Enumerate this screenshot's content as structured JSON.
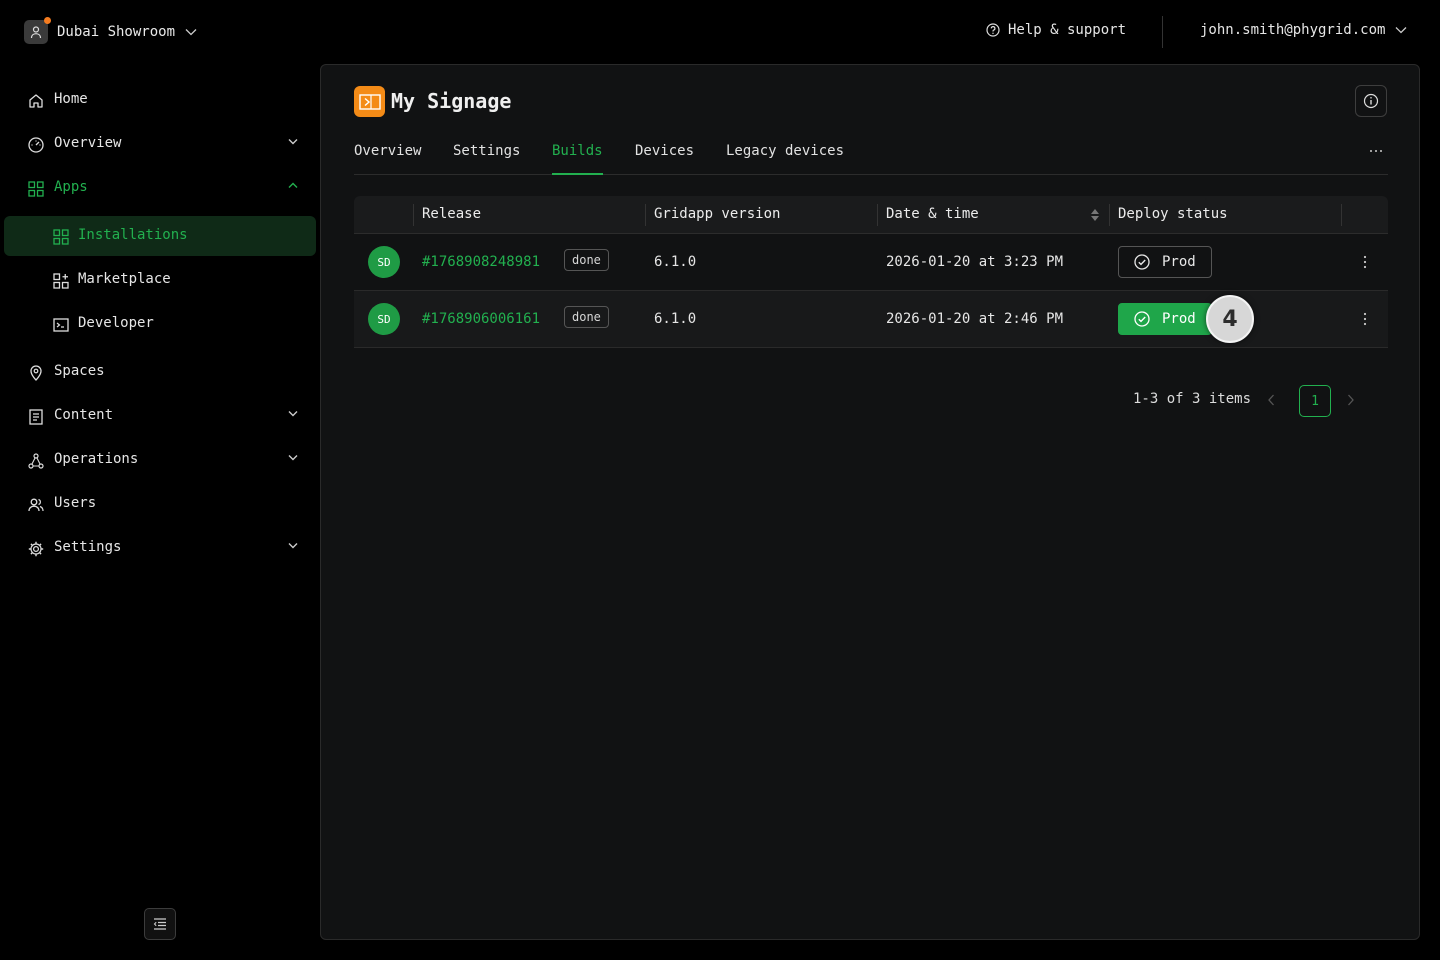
{
  "workspace": {
    "name": "Dubai Showroom"
  },
  "header": {
    "help_label": "Help & support",
    "user_email": "john.smith@phygrid.com"
  },
  "sidebar": {
    "items": [
      {
        "label": "Home"
      },
      {
        "label": "Overview"
      },
      {
        "label": "Apps"
      },
      {
        "label": "Installations"
      },
      {
        "label": "Marketplace"
      },
      {
        "label": "Developer"
      },
      {
        "label": "Spaces"
      },
      {
        "label": "Content"
      },
      {
        "label": "Operations"
      },
      {
        "label": "Users"
      },
      {
        "label": "Settings"
      }
    ]
  },
  "app": {
    "title": "My Signage"
  },
  "tabs": [
    {
      "label": "Overview"
    },
    {
      "label": "Settings"
    },
    {
      "label": "Builds",
      "active": true
    },
    {
      "label": "Devices"
    },
    {
      "label": "Legacy devices"
    }
  ],
  "table": {
    "columns": [
      "Release",
      "Gridapp version",
      "Date & time",
      "Deploy status"
    ],
    "rows": [
      {
        "avatar": "SD",
        "release": "#1768908248981",
        "status": "done",
        "version": "6.1.0",
        "datetime": "2026-01-20 at 3:23 PM",
        "deploy": "Prod",
        "deploy_filled": false
      },
      {
        "avatar": "SD",
        "release": "#1768906006161",
        "status": "done",
        "version": "6.1.0",
        "datetime": "2026-01-20 at 2:46 PM",
        "deploy": "Prod",
        "deploy_filled": true
      }
    ]
  },
  "step_marker": "4",
  "pagination": {
    "summary": "1-3 of 3 items",
    "current_page": "1"
  },
  "colors": {
    "accent": "#22b04f",
    "app_icon": "#f48b17",
    "background": "#000000",
    "panel": "#111213"
  }
}
